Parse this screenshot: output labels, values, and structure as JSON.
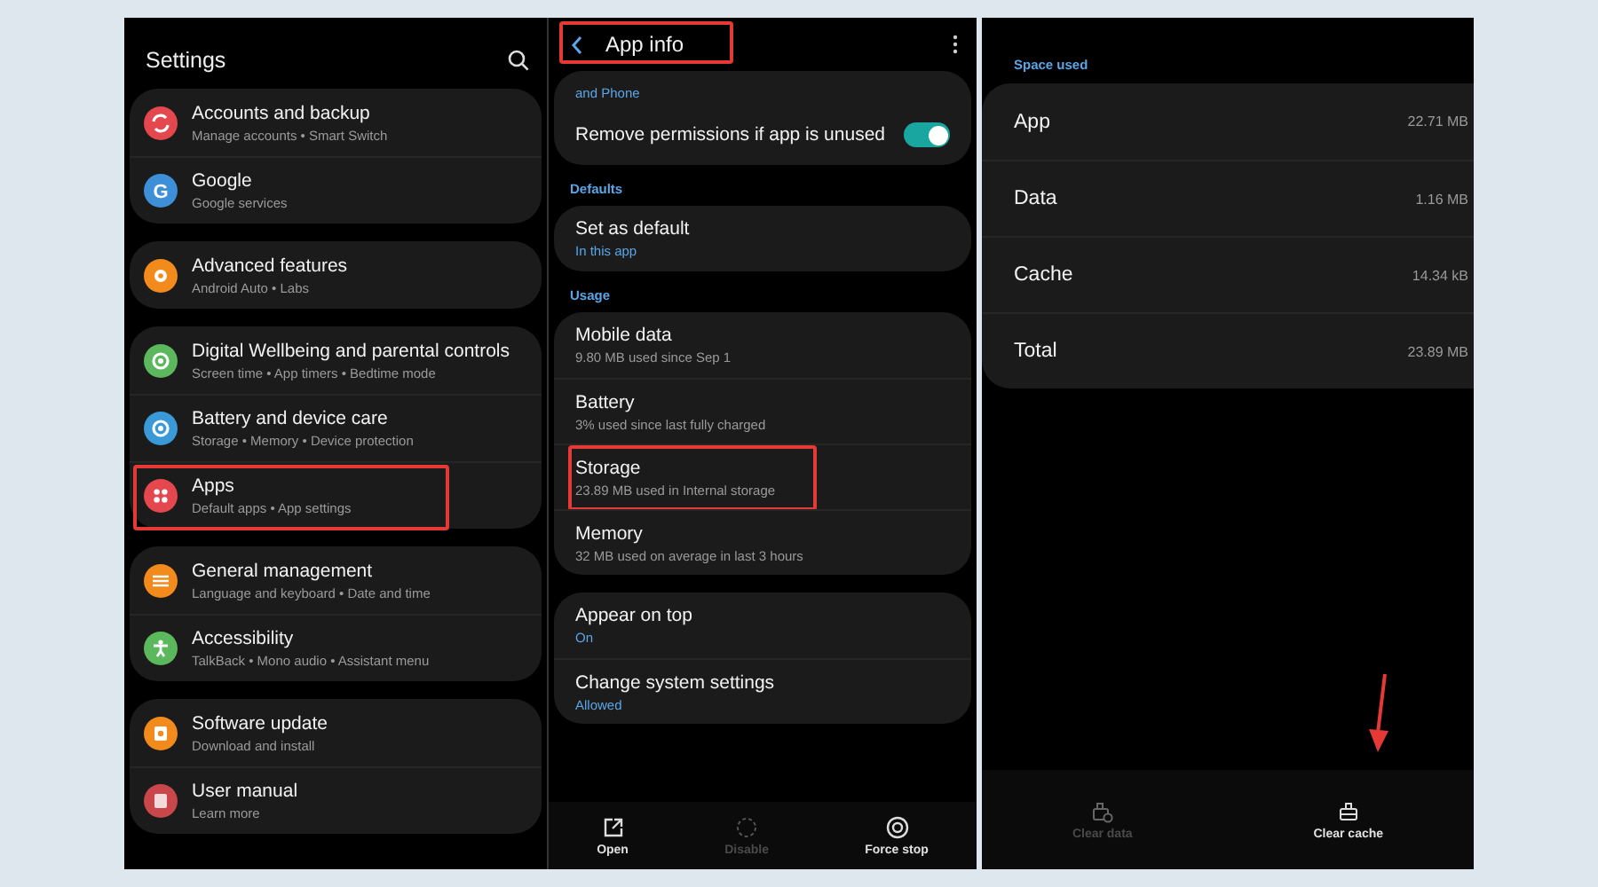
{
  "settings_screen": {
    "title": "Settings",
    "groups": [
      [
        {
          "title": "Accounts and backup",
          "subtitle": "Manage accounts • Smart Switch",
          "kind": "sync",
          "color": "#e5474e",
          "highlighted": false
        },
        {
          "title": "Google",
          "subtitle": "Google services",
          "kind": "letter",
          "icon_text": "G",
          "color": "#3d8fd8",
          "highlighted": false
        }
      ],
      [
        {
          "title": "Advanced features",
          "subtitle": "Android Auto • Labs",
          "kind": "gear",
          "color": "#f28a1c",
          "highlighted": false
        }
      ],
      [
        {
          "title": "Digital Wellbeing and parental controls",
          "subtitle": "Screen time • App timers • Bedtime mode",
          "kind": "ring",
          "color": "#5bb85d",
          "highlighted": false
        },
        {
          "title": "Battery and device care",
          "subtitle": "Storage • Memory • Device protection",
          "kind": "ring",
          "color": "#3a9ad8",
          "highlighted": false
        },
        {
          "title": "Apps",
          "subtitle": "Default apps • App settings",
          "kind": "grid",
          "color": "#e5474e",
          "highlighted": true
        }
      ],
      [
        {
          "title": "General management",
          "subtitle": "Language and keyboard • Date and time",
          "kind": "sliders",
          "color": "#f28a1c",
          "highlighted": false
        },
        {
          "title": "Accessibility",
          "subtitle": "TalkBack • Mono audio • Assistant menu",
          "kind": "person",
          "color": "#5bb85d",
          "highlighted": false
        }
      ],
      [
        {
          "title": "Software update",
          "subtitle": "Download and install",
          "kind": "update",
          "color": "#f28a1c",
          "highlighted": false
        },
        {
          "title": "User manual",
          "subtitle": "Learn more",
          "kind": "manual",
          "color": "#c9474b",
          "highlighted": false
        }
      ]
    ]
  },
  "app_info_screen": {
    "title": "App info",
    "highlighted": true,
    "sections": [
      {
        "rows": [
          {
            "kind": "link",
            "text": "and Phone"
          },
          {
            "kind": "toggle",
            "title": "Remove permissions if app is unused",
            "on": true
          }
        ]
      },
      {
        "label": "Defaults",
        "rows": [
          {
            "kind": "item",
            "title": "Set as default",
            "subtitle": "In this app",
            "accent": true,
            "highlighted": false
          }
        ]
      },
      {
        "label": "Usage",
        "rows": [
          {
            "kind": "item",
            "title": "Mobile data",
            "subtitle": "9.80 MB used since Sep 1",
            "accent": false,
            "highlighted": false
          },
          {
            "kind": "item",
            "title": "Battery",
            "subtitle": "3% used since last fully charged",
            "accent": false,
            "highlighted": false
          },
          {
            "kind": "item",
            "title": "Storage",
            "subtitle": "23.89 MB used in Internal storage",
            "accent": false,
            "highlighted": true
          },
          {
            "kind": "item",
            "title": "Memory",
            "subtitle": "32 MB used on average in last 3 hours",
            "accent": false,
            "highlighted": false
          }
        ]
      },
      {
        "rows": [
          {
            "kind": "item",
            "title": "Appear on top",
            "subtitle": "On",
            "accent": true,
            "highlighted": false
          },
          {
            "kind": "item",
            "title": "Change system settings",
            "subtitle": "Allowed",
            "accent": true,
            "highlighted": false
          }
        ]
      }
    ],
    "actions": [
      {
        "label": "Open",
        "kind": "open",
        "disabled": false
      },
      {
        "label": "Disable",
        "kind": "disable",
        "disabled": true
      },
      {
        "label": "Force stop",
        "kind": "stop",
        "disabled": false
      }
    ]
  },
  "storage_screen": {
    "section_label": "Space used",
    "rows": [
      {
        "label": "App",
        "value": "22.71 MB"
      },
      {
        "label": "Data",
        "value": "1.16 MB"
      },
      {
        "label": "Cache",
        "value": "14.34 kB"
      },
      {
        "label": "Total",
        "value": "23.89 MB"
      }
    ],
    "pointer_arrow": true,
    "actions": [
      {
        "label": "Clear data",
        "kind": "clear-data",
        "disabled": true
      },
      {
        "label": "Clear cache",
        "kind": "clear-cache",
        "disabled": false
      }
    ]
  }
}
